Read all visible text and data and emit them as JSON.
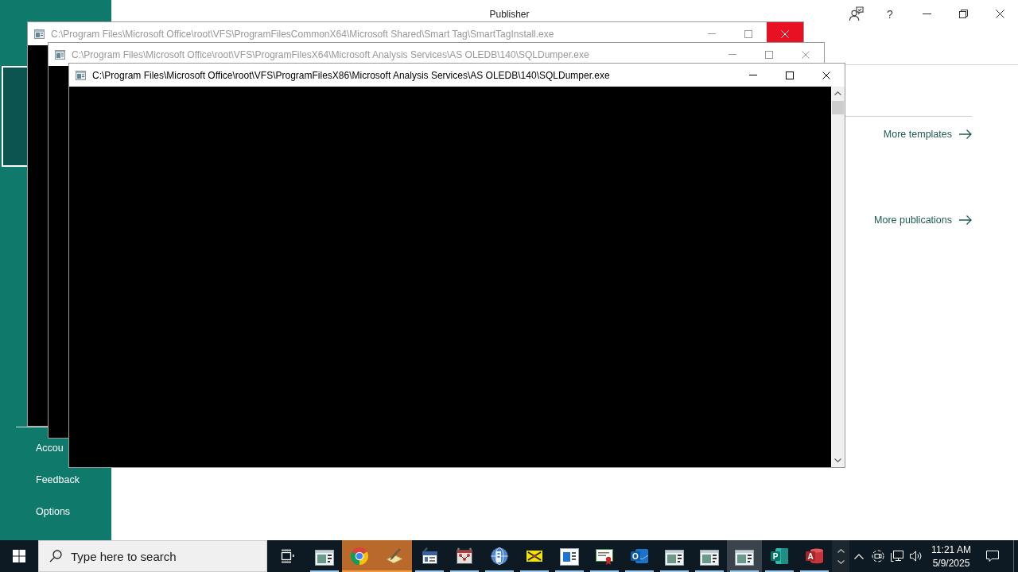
{
  "publisher": {
    "title": "Publisher",
    "help": "?"
  },
  "sidebar": {
    "highlight": {
      "selected": true
    },
    "items": [
      {
        "label": "Accou"
      },
      {
        "label": "Feedback"
      },
      {
        "label": "Options"
      }
    ]
  },
  "backstage": {
    "links": [
      {
        "label": "More templates"
      },
      {
        "label": "More publications"
      }
    ]
  },
  "consoles": [
    {
      "title": "C:\\Program Files\\Microsoft Office\\root\\VFS\\ProgramFilesCommonX64\\Microsoft Shared\\Smart Tag\\SmartTagInstall.exe",
      "active": false,
      "close_hovered": true
    },
    {
      "title": "C:\\Program Files\\Microsoft Office\\root\\VFS\\ProgramFilesX64\\Microsoft Analysis Services\\AS OLEDB\\140\\SQLDumper.exe",
      "active": false,
      "close_hovered": false
    },
    {
      "title": "C:\\Program Files\\Microsoft Office\\root\\VFS\\ProgramFilesX86\\Microsoft Analysis Services\\AS OLEDB\\140\\SQLDumper.exe",
      "active": true,
      "close_hovered": false
    }
  ],
  "taskbar": {
    "search": {
      "placeholder": "Type here to search"
    },
    "apps": [
      {
        "running": true,
        "flashing": false,
        "active": false
      },
      {
        "running": true,
        "flashing": true,
        "active": false
      },
      {
        "running": true,
        "flashing": true,
        "active": false
      },
      {
        "running": true,
        "flashing": false,
        "active": false
      },
      {
        "running": true,
        "flashing": false,
        "active": false
      },
      {
        "running": true,
        "flashing": false,
        "active": false
      },
      {
        "running": true,
        "flashing": false,
        "active": false
      },
      {
        "running": true,
        "flashing": false,
        "active": false
      },
      {
        "running": true,
        "flashing": false,
        "active": false
      },
      {
        "running": true,
        "flashing": false,
        "active": false,
        "letter": "O"
      },
      {
        "running": true,
        "flashing": false,
        "active": false
      },
      {
        "running": true,
        "flashing": false,
        "active": false
      },
      {
        "running": true,
        "flashing": false,
        "active": true
      },
      {
        "running": true,
        "flashing": false,
        "active": false,
        "letter": "P"
      },
      {
        "running": true,
        "flashing": false,
        "active": false,
        "letter": "A"
      }
    ],
    "clock": {
      "time": "11:21 AM",
      "date": "5/9/2025"
    }
  }
}
